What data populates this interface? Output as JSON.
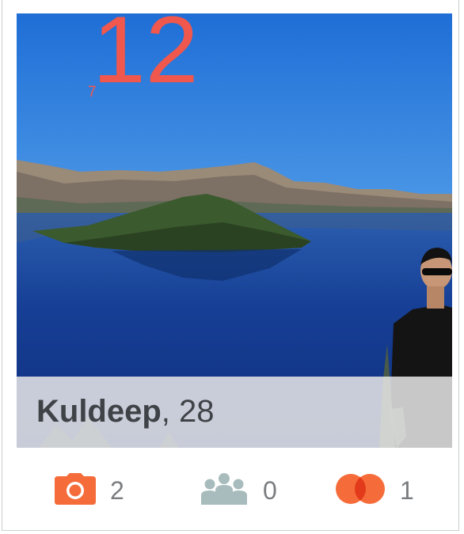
{
  "counter": {
    "big": "12",
    "small": "7"
  },
  "profile": {
    "name": "Kuldeep",
    "separator": ",",
    "age": "28"
  },
  "stats": {
    "photos": {
      "icon": "camera-icon",
      "count": "2",
      "color": "#f56c3a"
    },
    "friends": {
      "icon": "people-icon",
      "count": "0",
      "color": "#a9bcbd"
    },
    "mutual": {
      "icon": "interests-overlap-icon",
      "count": "1",
      "color": "#f56c3a"
    }
  },
  "colors": {
    "accent": "#f0574d",
    "name_text": "#3f4347",
    "count_text": "#7a7d80"
  }
}
